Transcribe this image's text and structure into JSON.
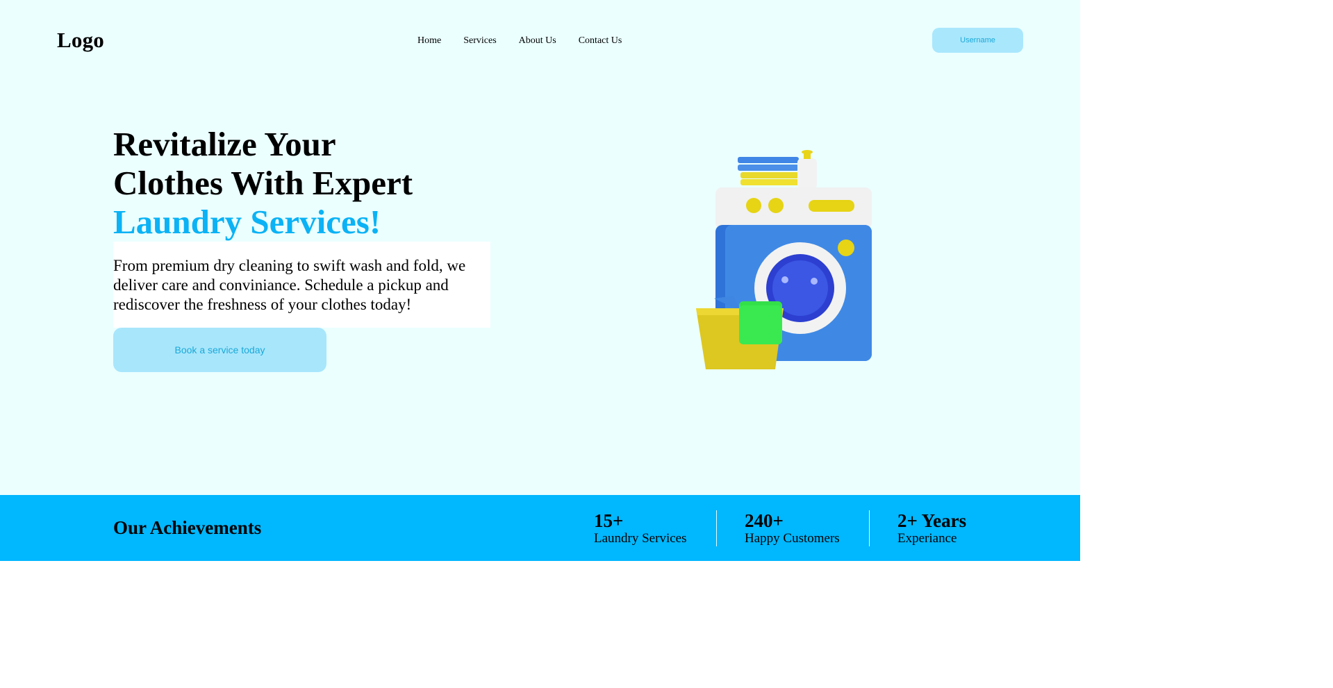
{
  "header": {
    "logo": "Logo",
    "nav": [
      "Home",
      "Services",
      "About Us",
      "Contact Us"
    ],
    "user_button": "Username"
  },
  "hero": {
    "title_line1": "Revitalize Your",
    "title_line2": "Clothes With Expert",
    "title_line3": "Laundry Services!",
    "description": "From premium dry cleaning to swift wash and fold, we deliver care and conviniance. Schedule a pickup and rediscover the freshness of your clothes today!",
    "cta": "Book a service today",
    "illustration": "washing-machine-illustration"
  },
  "achievements": {
    "title": "Our Achievements",
    "stats": [
      {
        "value": "15+",
        "label": "Laundry Services"
      },
      {
        "value": "240+",
        "label": "Happy Customers"
      },
      {
        "value": "2+ Years",
        "label": "Experiance"
      }
    ]
  },
  "colors": {
    "background": "#ebffff",
    "accent": "#0bb2f5",
    "band": "#01b7fe",
    "button": "#a8e6fc"
  }
}
